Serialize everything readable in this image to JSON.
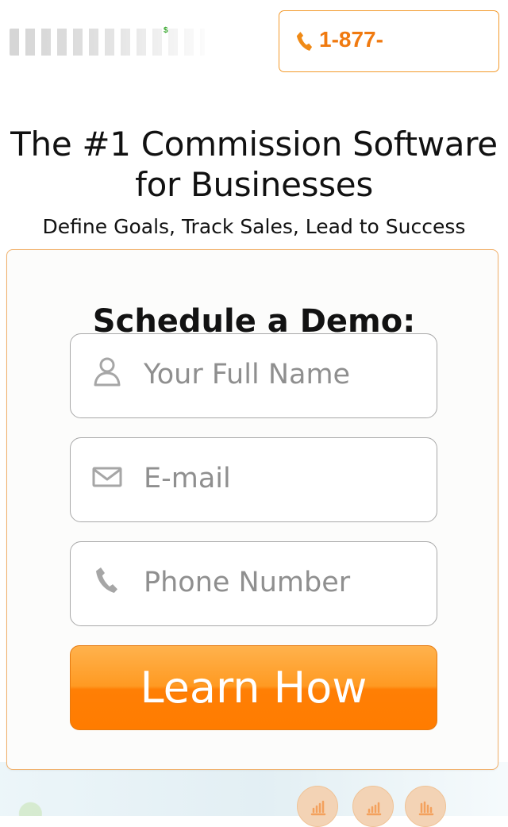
{
  "header": {
    "logo_alt": "company logo",
    "logo_mark": "$",
    "phone_label": "1-877-"
  },
  "hero": {
    "title": "The #1 Commission Software for Businesses",
    "subtitle": "Define Goals, Track Sales, Lead to Success"
  },
  "form": {
    "heading": "Schedule a Demo:",
    "name_placeholder": "Your Full Name",
    "email_placeholder": "E-mail",
    "phone_placeholder": "Phone Number",
    "submit_label": "Learn How"
  },
  "colors": {
    "accent": "#ff7f05",
    "accent_light": "#ffb24d",
    "border": "#a8a8a8"
  },
  "icons": {
    "phone": "phone-icon",
    "user": "user-icon",
    "mail": "mail-icon",
    "chart": "chart-icon"
  }
}
